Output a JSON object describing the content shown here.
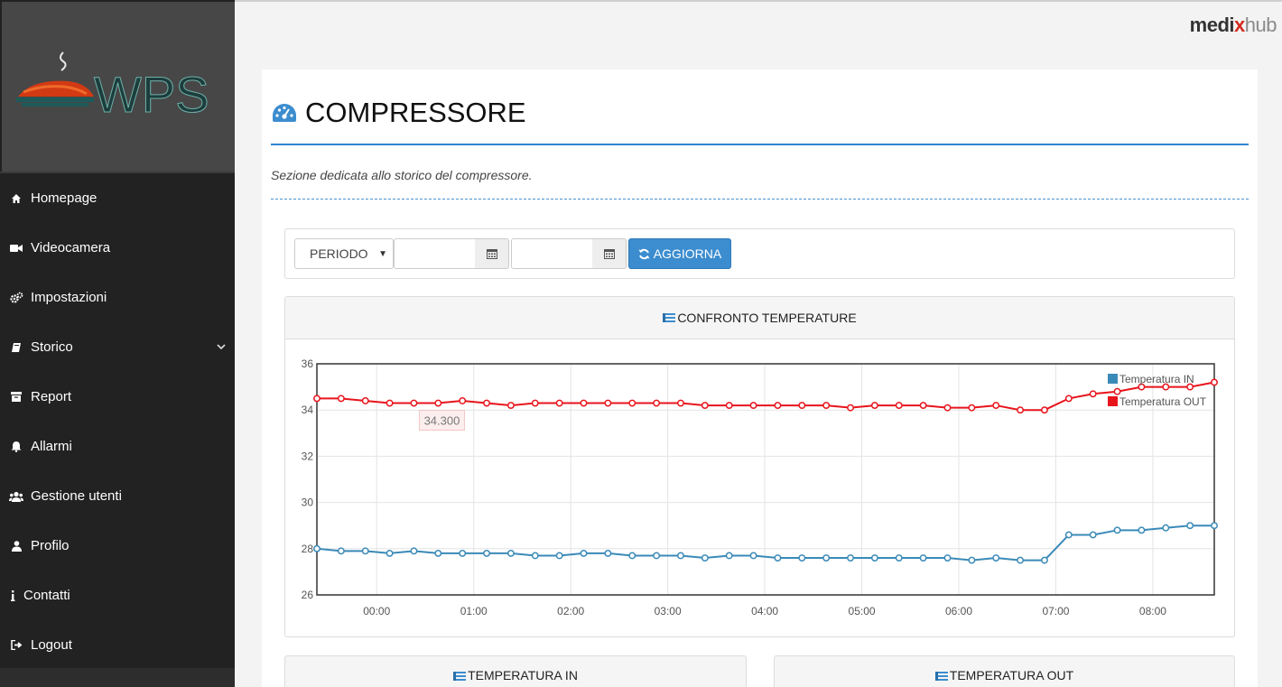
{
  "brand": {
    "part1": "medi",
    "part2": "x",
    "part3": "hub"
  },
  "logo": {
    "text": "WPS"
  },
  "sidebar": {
    "items": [
      {
        "label": "Homepage",
        "icon": "home-icon"
      },
      {
        "label": "Videocamera",
        "icon": "video-camera-icon"
      },
      {
        "label": "Impostazioni",
        "icon": "cogs-icon"
      },
      {
        "label": "Storico",
        "icon": "book-icon",
        "expandable": true
      },
      {
        "label": "Report",
        "icon": "archive-icon"
      },
      {
        "label": "Allarmi",
        "icon": "bell-icon"
      },
      {
        "label": "Gestione utenti",
        "icon": "users-icon"
      },
      {
        "label": "Profilo",
        "icon": "user-icon"
      },
      {
        "label": "Contatti",
        "icon": "info-icon"
      },
      {
        "label": "Logout",
        "icon": "sign-out-icon"
      }
    ]
  },
  "page": {
    "title": "COMPRESSORE",
    "subtitle": "Sezione dedicata allo storico del compressore."
  },
  "filters": {
    "period_label": "PERIODO",
    "date_from": "",
    "date_to": "",
    "update_label": "AGGIORNA"
  },
  "panels": {
    "comparison_title": "CONFRONTO TEMPERATURE",
    "temp_in_title": "TEMPERATURA IN",
    "temp_out_title": "TEMPERATURA OUT"
  },
  "colors": {
    "accent": "#3c8dcf",
    "series_in": "#3a8ab8",
    "series_out": "#e8141c"
  },
  "chart_data": {
    "type": "line",
    "title": "",
    "xlabel": "",
    "ylabel": "",
    "ylim": [
      26,
      36
    ],
    "yticks": [
      26,
      28,
      30,
      32,
      34,
      36
    ],
    "xticks": [
      "00:00",
      "01:00",
      "02:00",
      "03:00",
      "04:00",
      "05:00",
      "06:00",
      "07:00",
      "08:00"
    ],
    "x_start_time": "23:23",
    "x_interval_minutes": 15,
    "grid": true,
    "legend_position": "top-right",
    "tooltip": {
      "series": "Temperatura OUT",
      "index": 4,
      "value": "34.300"
    },
    "series": [
      {
        "name": "Temperatura IN",
        "color": "#3a8ab8",
        "values": [
          28.0,
          27.9,
          27.9,
          27.8,
          27.9,
          27.8,
          27.8,
          27.8,
          27.8,
          27.7,
          27.7,
          27.8,
          27.8,
          27.7,
          27.7,
          27.7,
          27.6,
          27.7,
          27.7,
          27.6,
          27.6,
          27.6,
          27.6,
          27.6,
          27.6,
          27.6,
          27.6,
          27.5,
          27.6,
          27.5,
          27.5,
          28.6,
          28.6,
          28.8,
          28.8,
          28.9,
          29.0,
          29.0
        ]
      },
      {
        "name": "Temperatura OUT",
        "color": "#e8141c",
        "values": [
          34.5,
          34.5,
          34.4,
          34.3,
          34.3,
          34.3,
          34.4,
          34.3,
          34.2,
          34.3,
          34.3,
          34.3,
          34.3,
          34.3,
          34.3,
          34.3,
          34.2,
          34.2,
          34.2,
          34.2,
          34.2,
          34.2,
          34.1,
          34.2,
          34.2,
          34.2,
          34.1,
          34.1,
          34.2,
          34.0,
          34.0,
          34.5,
          34.7,
          34.8,
          35.0,
          35.0,
          35.0,
          35.2
        ]
      }
    ]
  }
}
